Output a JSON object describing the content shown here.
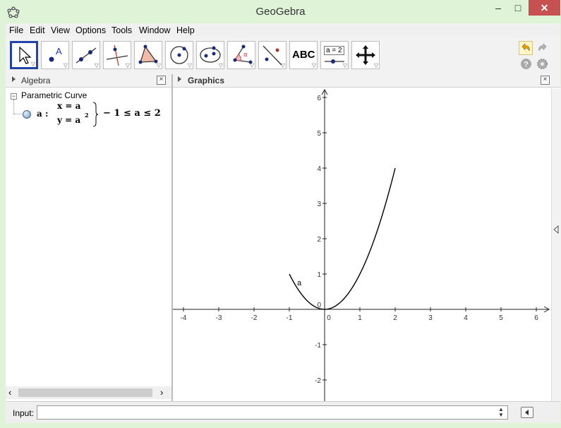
{
  "window": {
    "title": "GeoGebra",
    "minimize_label": "–",
    "maximize_label": "□",
    "close_label": "✕"
  },
  "menu": [
    "File",
    "Edit",
    "View",
    "Options",
    "Tools",
    "Window",
    "Help"
  ],
  "toolbar": {
    "tools": [
      {
        "name": "move-tool",
        "icon": "cursor-arrow",
        "selected": true
      },
      {
        "name": "point-tool",
        "icon": "point-A",
        "label": "A"
      },
      {
        "name": "line-tool",
        "icon": "line-through-points"
      },
      {
        "name": "perpendicular-line-tool",
        "icon": "perpendicular-line"
      },
      {
        "name": "polygon-tool",
        "icon": "polygon"
      },
      {
        "name": "circle-tool",
        "icon": "circle-center-point"
      },
      {
        "name": "ellipse-tool",
        "icon": "ellipse"
      },
      {
        "name": "angle-tool",
        "icon": "angle",
        "label": "α"
      },
      {
        "name": "reflect-tool",
        "icon": "reflect-about-line"
      },
      {
        "name": "text-tool",
        "icon": "text",
        "label": "ABC"
      },
      {
        "name": "slider-tool",
        "icon": "slider",
        "label": "a = 2"
      },
      {
        "name": "move-graphics-tool",
        "icon": "move-arrows"
      }
    ],
    "undo_icon": "undo-icon",
    "redo_icon": "redo-icon",
    "help_icon": "help-icon",
    "settings_icon": "gear-icon"
  },
  "algebra": {
    "title": "Algebra",
    "close": "×",
    "group": {
      "label": "Parametric Curve",
      "toggle": "−"
    },
    "item": {
      "name": "a :",
      "eq_x": "x = a",
      "eq_y": "y = a",
      "exp": "2",
      "constraint": "− 1 ≤ a ≤ 2"
    },
    "scroll_left": "‹",
    "scroll_right": "›"
  },
  "graphics": {
    "title": "Graphics",
    "close": "×",
    "curve_label": "a"
  },
  "input": {
    "label": "Input:",
    "value": "",
    "placeholder": ""
  },
  "chart_data": {
    "type": "line",
    "title": "",
    "xlabel": "",
    "ylabel": "",
    "xlim": [
      -4.3,
      6.5
    ],
    "ylim": [
      -2.5,
      6.2
    ],
    "x_ticks": [
      -4,
      -3,
      -2,
      -1,
      0,
      1,
      2,
      3,
      4,
      5,
      6
    ],
    "y_ticks": [
      -2,
      -1,
      1,
      2,
      3,
      4,
      5,
      6
    ],
    "grid": false,
    "series": [
      {
        "name": "a",
        "color": "#000000",
        "param_range": [
          -1,
          2
        ],
        "x": [
          -1,
          -0.75,
          -0.5,
          -0.25,
          0,
          0.25,
          0.5,
          0.75,
          1,
          1.25,
          1.5,
          1.75,
          2
        ],
        "y": [
          1,
          0.5625,
          0.25,
          0.0625,
          0,
          0.0625,
          0.25,
          0.5625,
          1,
          1.5625,
          2.25,
          3.0625,
          4
        ]
      }
    ]
  }
}
